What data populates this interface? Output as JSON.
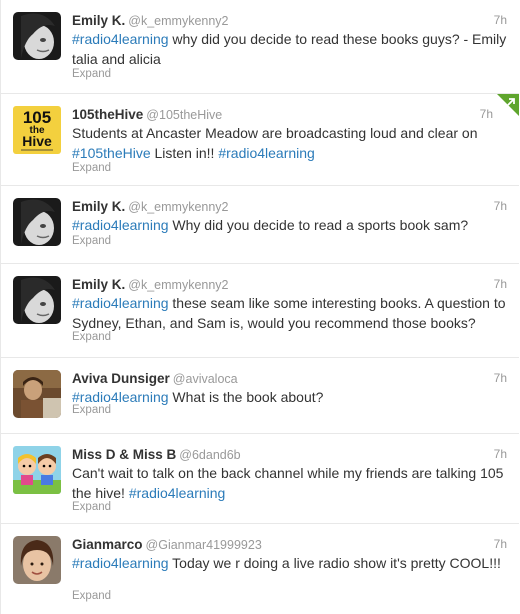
{
  "colors": {
    "link": "#2b7bb9",
    "meta": "#999999",
    "text": "#333333",
    "retweet_badge": "#5fa52d"
  },
  "tweets": [
    {
      "name": "Emily K.",
      "handle": "@k_emmykenny2",
      "time": "7h",
      "hashtag": "#radio4learning",
      "text": " why did you decide to read these books guys? - Emily talia and alicia",
      "expand": "Expand",
      "avatar": "emily-avatar-icon"
    },
    {
      "name": "105theHive",
      "handle": "@105theHive",
      "time": "7h",
      "text_before": "Students at Ancaster Meadow are broadcasting loud and clear on ",
      "hashtag": "#105theHive",
      "text_middle": " Listen in!! ",
      "hashtag2": "#radio4learning",
      "expand": "Expand",
      "avatar": "hive-logo-icon",
      "logo_line1": "105",
      "logo_line2": "the",
      "logo_line3": "Hive",
      "badge": "retweet-corner-icon"
    },
    {
      "name": "Emily K.",
      "handle": "@k_emmykenny2",
      "time": "7h",
      "hashtag": "#radio4learning",
      "text": " Why did you decide to read a sports book sam?",
      "expand": "Expand",
      "avatar": "emily-avatar-icon"
    },
    {
      "name": "Emily K.",
      "handle": "@k_emmykenny2",
      "time": "7h",
      "hashtag": "#radio4learning",
      "text": " these seam like some interesting books. A question to Sydney, Ethan, and Sam is, would you recommend those books?",
      "expand": "Expand",
      "avatar": "emily-avatar-icon"
    },
    {
      "name": "Aviva Dunsiger",
      "handle": "@avivaloca",
      "time": "7h",
      "hashtag": "#radio4learning",
      "text": " What is the book about?",
      "expand": "Expand",
      "avatar": "aviva-avatar-icon"
    },
    {
      "name": "Miss D & Miss B",
      "handle": "@6dand6b",
      "time": "7h",
      "text_before": "Can't wait to talk on the back channel while my friends are talking 105 the hive! ",
      "hashtag": "#radio4learning",
      "expand": "Expand",
      "avatar": "cartoon-avatar-icon"
    },
    {
      "name": "Gianmarco",
      "handle": "@Gianmar41999923",
      "time": "7h",
      "hashtag": "#radio4learning",
      "text": " Today we r doing a live radio show it's pretty COOL!!!",
      "expand": "Expand",
      "avatar": "gianmarco-avatar-icon"
    }
  ]
}
